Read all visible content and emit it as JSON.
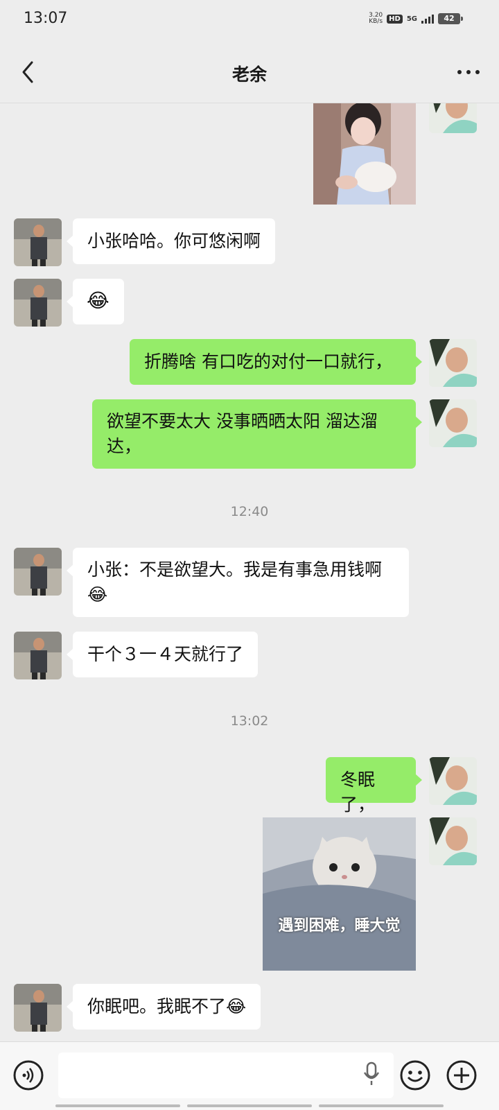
{
  "status_bar": {
    "time": "13:07",
    "speed_value": "3.20",
    "speed_unit": "KB/s",
    "hd_badge": "HD",
    "network": "5G",
    "battery": "42"
  },
  "header": {
    "title": "老余",
    "back_icon": "chevron-left-icon",
    "more_icon": "more-dots-icon"
  },
  "messages": [
    {
      "type": "image",
      "side": "out",
      "description_icon": "photo-girl-with-cat"
    },
    {
      "type": "text",
      "side": "in",
      "text": "小张哈哈。你可悠闲啊"
    },
    {
      "type": "emoji",
      "side": "in",
      "emoji": "😂"
    },
    {
      "type": "text",
      "side": "out",
      "text": "折腾啥 有口吃的对付一口就行，"
    },
    {
      "type": "text",
      "side": "out",
      "text": "欲望不要太大 没事晒晒太阳 溜达溜达，"
    },
    {
      "type": "timestamp",
      "text": "12:40"
    },
    {
      "type": "text",
      "side": "in",
      "text": "小张：不是欲望大。我是有事急用钱啊",
      "emoji": "😂"
    },
    {
      "type": "text",
      "side": "in",
      "text": "干个３一４天就行了"
    },
    {
      "type": "timestamp",
      "text": "13:02"
    },
    {
      "type": "text",
      "side": "out",
      "text": "冬眠了，"
    },
    {
      "type": "sticker",
      "side": "out",
      "caption": "遇到困难，睡大觉"
    },
    {
      "type": "text",
      "side": "in",
      "text": "你眠吧。我眠不了",
      "emoji": "😂"
    }
  ],
  "input_bar": {
    "voice_icon": "voice-icon",
    "mic_icon": "mic-icon",
    "emoji_icon": "smile-icon",
    "plus_icon": "plus-icon"
  }
}
